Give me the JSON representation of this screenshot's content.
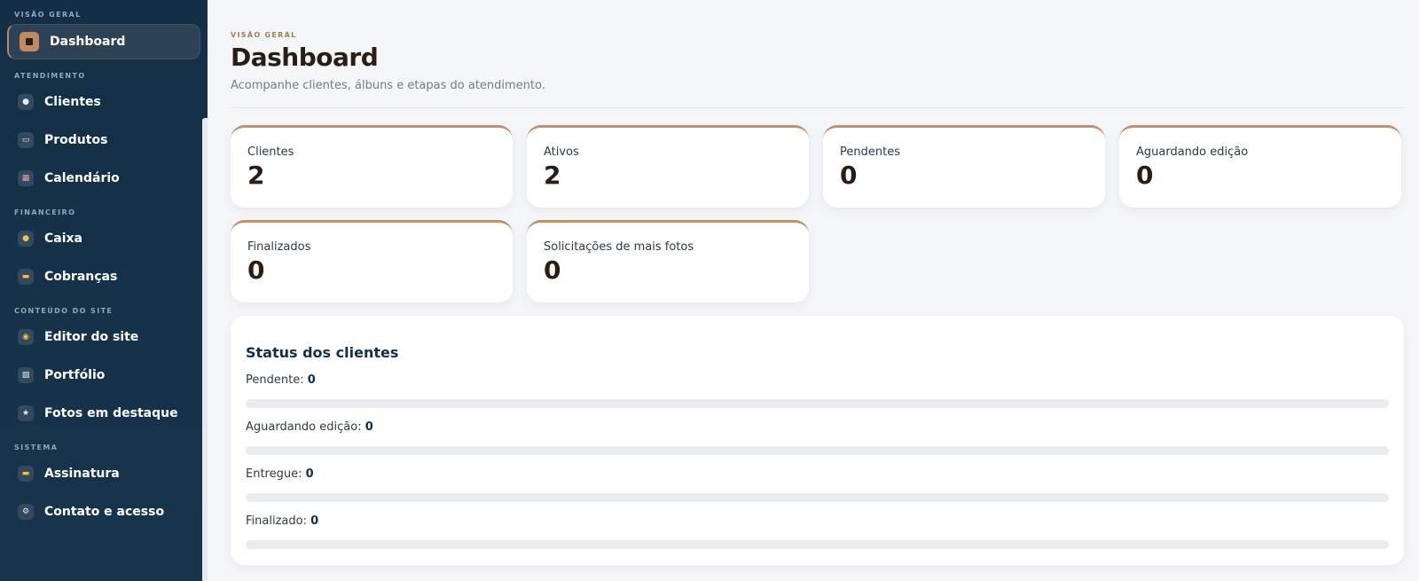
{
  "sidebar": {
    "sections": [
      {
        "label": "VISÃO GERAL",
        "items": [
          {
            "label": "Dashboard",
            "icon": "square-icon",
            "active": true
          }
        ]
      },
      {
        "label": "ATENDIMENTO",
        "items": [
          {
            "label": "Clientes",
            "icon": "clients-icon"
          },
          {
            "label": "Produtos",
            "icon": "products-icon"
          },
          {
            "label": "Calendário",
            "icon": "calendar-icon"
          }
        ]
      },
      {
        "label": "FINANCEIRO",
        "items": [
          {
            "label": "Caixa",
            "icon": "money-bag-icon"
          },
          {
            "label": "Cobranças",
            "icon": "credit-card-icon"
          }
        ]
      },
      {
        "label": "CONTEÚDO DO SITE",
        "items": [
          {
            "label": "Editor do site",
            "icon": "palette-icon"
          },
          {
            "label": "Portfólio",
            "icon": "image-icon"
          },
          {
            "label": "Fotos em destaque",
            "icon": "star-icon"
          }
        ]
      },
      {
        "label": "SISTEMA",
        "items": [
          {
            "label": "Assinatura",
            "icon": "credit-card-icon"
          },
          {
            "label": "Contato e acesso",
            "icon": "gear-icon"
          }
        ]
      }
    ]
  },
  "header": {
    "eyebrow": "VISÃO GERAL",
    "title": "Dashboard",
    "subtitle": "Acompanhe clientes, álbuns e etapas do atendimento."
  },
  "stats": [
    {
      "label": "Clientes",
      "value": "2"
    },
    {
      "label": "Ativos",
      "value": "2"
    },
    {
      "label": "Pendentes",
      "value": "0"
    },
    {
      "label": "Aguardando edição",
      "value": "0"
    },
    {
      "label": "Finalizados",
      "value": "0"
    },
    {
      "label": "Solicitações de mais fotos",
      "value": "0"
    }
  ],
  "status_panel": {
    "title": "Status dos clientes",
    "rows": [
      {
        "label": "Pendente:",
        "value": "0",
        "fraction": 0
      },
      {
        "label": "Aguardando edição:",
        "value": "0",
        "fraction": 0
      },
      {
        "label": "Entregue:",
        "value": "0",
        "fraction": 0
      },
      {
        "label": "Finalizado:",
        "value": "0",
        "fraction": 0
      }
    ]
  },
  "colors": {
    "sidebar_bg": "#142f45",
    "accent": "#c0906b",
    "title": "#2a1d15"
  }
}
